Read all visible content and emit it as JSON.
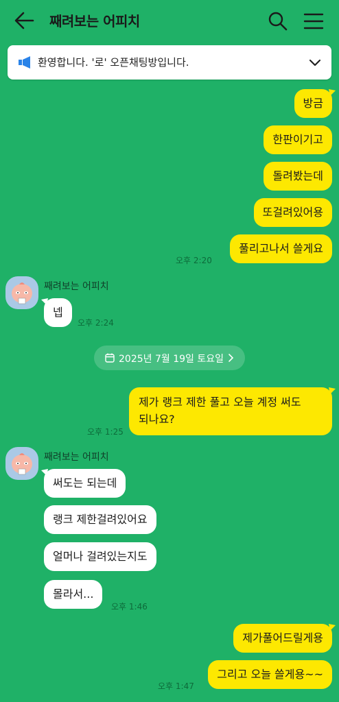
{
  "header": {
    "title": "째려보는 어피치",
    "icons": [
      "back-arrow-icon",
      "search-icon",
      "menu-icon"
    ]
  },
  "notice": {
    "text": "환영합니다. '로' 오픈채팅방입니다."
  },
  "chat": {
    "out_block1": [
      "방금",
      "한판이기고",
      "돌려봤는데",
      "또걸려있어용",
      "풀리고나서 쓸게요"
    ],
    "out_block1_time": "오후 2:20",
    "in_block1_sender": "째려보는 어피치",
    "in_block1": [
      "넵"
    ],
    "in_block1_time": "오후 2:24",
    "date_divider": "2025년 7월 19일 토요일",
    "out_block2_line1": "제가 랭크 제한 풀고 오늘 계정 써도",
    "out_block2_line2": "되나요?",
    "out_block2_time": "오후 1:25",
    "in_block2_sender": "째려보는 어피치",
    "in_block2": [
      "써도는 되는데",
      "랭크 제한걸려있어요",
      "얼머나 걸려있는지도",
      "몰라서..."
    ],
    "in_block2_time": "오후 1:46",
    "out_block3": [
      "제가풀어드릴게용",
      "그리고 오늘 쓸게용~~"
    ],
    "out_block3_time": "오후 1:47"
  },
  "colors": {
    "background": "#1fb167",
    "outgoing_bubble": "#fde801",
    "incoming_bubble": "#ffffff"
  }
}
